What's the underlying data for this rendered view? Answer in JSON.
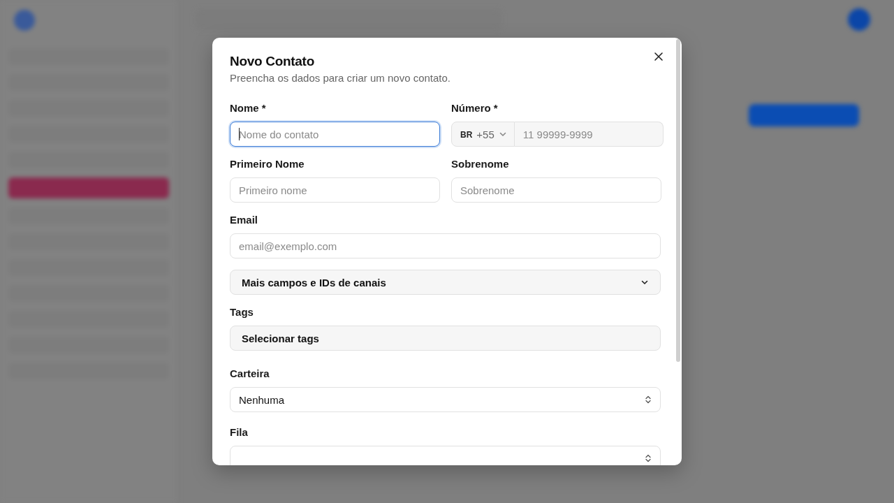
{
  "dialog": {
    "title": "Novo Contato",
    "subtitle": "Preencha os dados para criar um novo contato.",
    "rows": [
      [
        {
          "kind": "text",
          "label": "Nome *",
          "placeholder": "Nome do contato",
          "focused": true
        },
        {
          "kind": "phone",
          "label": "Número *",
          "country": "BR",
          "code": "+55",
          "placeholder": "11 99999-9999"
        }
      ],
      [
        {
          "kind": "text",
          "label": "Primeiro Nome",
          "placeholder": "Primeiro nome",
          "focused": false
        },
        {
          "kind": "text",
          "label": "Sobrenome",
          "placeholder": "Sobrenome",
          "focused": false
        }
      ],
      [
        {
          "kind": "text",
          "label": "Email",
          "placeholder": "email@exemplo.com",
          "focused": false
        }
      ],
      [
        {
          "kind": "collapsible",
          "title": "Mais campos e IDs de canais",
          "expanded": false
        }
      ],
      [
        {
          "kind": "tags",
          "label": "Tags",
          "value": "Selecionar tags"
        }
      ],
      [
        {
          "kind": "select",
          "label": "Carteira",
          "value": "Nenhuma"
        }
      ],
      [
        {
          "kind": "select",
          "label": "Fila"
        }
      ]
    ]
  }
}
